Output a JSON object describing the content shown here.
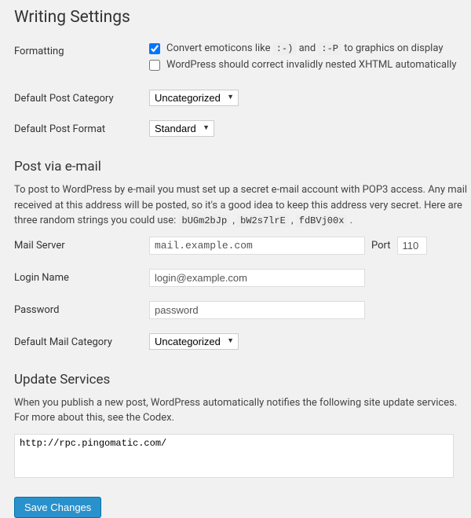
{
  "page_title": "Writing Settings",
  "formatting": {
    "label": "Formatting",
    "emoticons": {
      "checked": true,
      "text_pre": "Convert emoticons like ",
      "code1": ":-)",
      "text_mid": " and ",
      "code2": ":-P",
      "text_post": " to graphics on display"
    },
    "xhtml": {
      "checked": false,
      "label": "WordPress should correct invalidly nested XHTML automatically"
    }
  },
  "default_post_category": {
    "label": "Default Post Category",
    "value": "Uncategorized"
  },
  "default_post_format": {
    "label": "Default Post Format",
    "value": "Standard"
  },
  "post_via_email": {
    "heading": "Post via e-mail",
    "desc_pre": "To post to WordPress by e-mail you must set up a secret e-mail account with POP3 access. Any mail received at this address will be posted, so it's a good idea to keep this address very secret. Here are three random strings you could use: ",
    "rand1": "bUGm2bJp",
    "sep": " , ",
    "rand2": "bW2s7lrE",
    "rand3": "fdBVj00x",
    "period": " ."
  },
  "mail_server": {
    "label": "Mail Server",
    "value": "mail.example.com",
    "port_label": "Port",
    "port": "110"
  },
  "login_name": {
    "label": "Login Name",
    "value": "login@example.com"
  },
  "password": {
    "label": "Password",
    "value": "password"
  },
  "default_mail_category": {
    "label": "Default Mail Category",
    "value": "Uncategorized"
  },
  "update_services": {
    "heading": "Update Services",
    "desc": "When you publish a new post, WordPress automatically notifies the following site update services. For more about this, see the Codex.",
    "value": "http://rpc.pingomatic.com/"
  },
  "save_button": "Save Changes"
}
